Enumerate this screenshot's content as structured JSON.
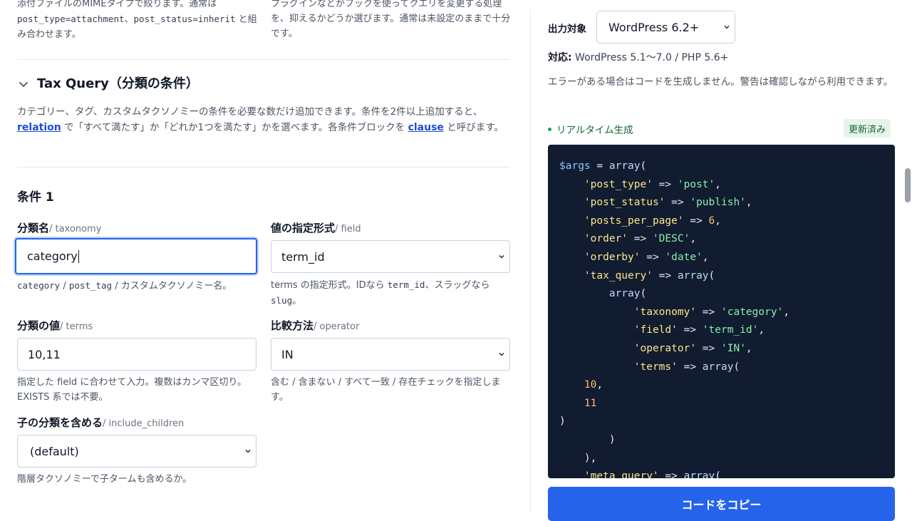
{
  "top": {
    "left_desc_html": "添付ファイルのMIMEタイプで絞ります。通常は <code>post_type=attachment</code>、<code>post_status=inherit</code> と組み合わせます。",
    "right_desc": "プラグインなどがフックを使ってクエリを変更する処理を、抑えるかどうか選びます。通常は未設定のままで十分です。"
  },
  "tax_query": {
    "title": "Tax Query（分類の条件）",
    "desc_part1": "カテゴリー、タグ、カスタムタクソノミーの条件を必要な数だけ追加できます。条件を2件以上追加すると、",
    "relation_link": "relation",
    "desc_part2": " で「すべて満たす」か「どれか1つを満たす」かを選べます。各条件ブロックを ",
    "clause_link": "clause",
    "desc_part3": " と呼びます。",
    "condition_title": "条件 1",
    "fields": {
      "taxonomy": {
        "label": "分類名",
        "sub": "/ taxonomy",
        "value": "category",
        "help_html": "<code>category</code> / <code>post_tag</code> / カスタムタクソノミー名。"
      },
      "field": {
        "label": "値の指定形式",
        "sub": "/ field",
        "value": "term_id",
        "help_html": "terms の指定形式。IDなら <code>term_id</code>、スラッグなら <code>slug</code>。"
      },
      "terms": {
        "label": "分類の値",
        "sub": "/ terms",
        "value": "10,11",
        "help": "指定した field に合わせて入力。複数はカンマ区切り。EXISTS 系では不要。"
      },
      "operator": {
        "label": "比較方法",
        "sub": "/ operator",
        "value": "IN",
        "help": "含む / 含まない / すべて一致 / 存在チェックを指定します。"
      },
      "include_children": {
        "label": "子の分類を含める",
        "sub": "/ include_children",
        "value": "(default)",
        "help": "階層タクソノミーで子タームも含めるか。"
      }
    }
  },
  "panel": {
    "output_label": "出力対象",
    "output_value": "WordPress 6.2+",
    "compat_label": "対応:",
    "compat_value": " WordPress 5.1〜7.0 / PHP 5.6+",
    "warning": "エラーがある場合はコードを生成しません。警告は確認しながら利用できます。",
    "realtime": "リアルタイム生成",
    "status_badge": "更新済み",
    "copy_button": "コードをコピー"
  },
  "code_html": "<span class=\"t-var\">$args</span> = <span class=\"t-fn\">array</span>(\n    <span class=\"t-key\">'post_type'</span> => <span class=\"t-str\">'post'</span>,\n    <span class=\"t-key\">'post_status'</span> => <span class=\"t-str\">'publish'</span>,\n    <span class=\"t-key\">'posts_per_page'</span> => <span class=\"t-num\">6</span>,\n    <span class=\"t-key\">'order'</span> => <span class=\"t-str\">'DESC'</span>,\n    <span class=\"t-key\">'orderby'</span> => <span class=\"t-str\">'date'</span>,\n    <span class=\"t-key\">'tax_query'</span> => <span class=\"t-fn\">array</span>(\n        <span class=\"t-fn\">array</span>(\n            <span class=\"t-key\">'taxonomy'</span> => <span class=\"t-str\">'category'</span>,\n            <span class=\"t-key\">'field'</span> => <span class=\"t-str\">'term_id'</span>,\n            <span class=\"t-key\">'operator'</span> => <span class=\"t-str\">'IN'</span>,\n            <span class=\"t-key\">'terms'</span> => <span class=\"t-fn\">array</span>(\n    <span class=\"t-num\">10</span>,\n    <span class=\"t-num\">11</span>\n)\n        )\n    ),\n    <span class=\"t-key\">'meta_query'</span> => <span class=\"t-fn\">array</span>("
}
